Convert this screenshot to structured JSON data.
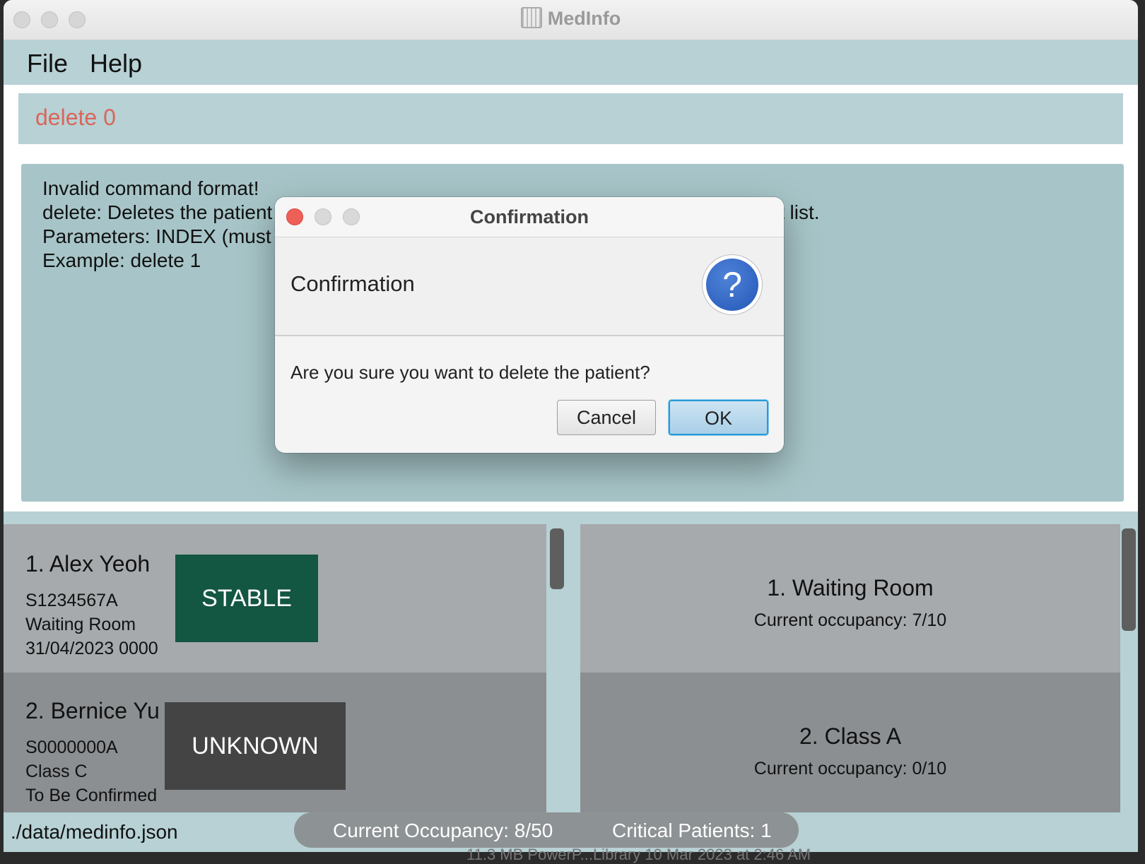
{
  "window": {
    "title": "MedInfo"
  },
  "menu": {
    "file": "File",
    "help": "Help"
  },
  "command": {
    "text": "delete 0",
    "color": "#d9665a"
  },
  "result": {
    "lines": [
      "Invalid command format!",
      "delete: Deletes the patient",
      "Parameters: INDEX (must b",
      "Example: delete 1"
    ],
    "tail": "t list."
  },
  "dialog": {
    "title": "Confirmation",
    "header": "Confirmation",
    "icon": "question-icon",
    "icon_glyph": "?",
    "message": "Are you sure you want to delete the patient?",
    "cancel_label": "Cancel",
    "ok_label": "OK"
  },
  "patients": [
    {
      "index_name": "1.  Alex Yeoh",
      "nric": "S1234567A",
      "ward": "Waiting Room",
      "discharge": "31/04/2023 0000",
      "status": "STABLE",
      "status_color": "#135641"
    },
    {
      "index_name": "2.  Bernice Yu",
      "nric": "S0000000A",
      "ward": "Class C",
      "discharge": "To Be Confirmed",
      "status": "UNKNOWN",
      "status_color": "#444444"
    }
  ],
  "wards": [
    {
      "index_name": "1.  Waiting Room",
      "occupancy": "Current occupancy: 7/10"
    },
    {
      "index_name": "2.  Class A",
      "occupancy": "Current occupancy: 0/10"
    }
  ],
  "status_bar": {
    "path": "./data/medinfo.json",
    "occupancy": "Current Occupancy: 8/50",
    "critical": "Critical Patients: 1"
  },
  "background_text": "11.3 MB   PowerP...Library   10 Mar 2023 at 2:46 AM"
}
